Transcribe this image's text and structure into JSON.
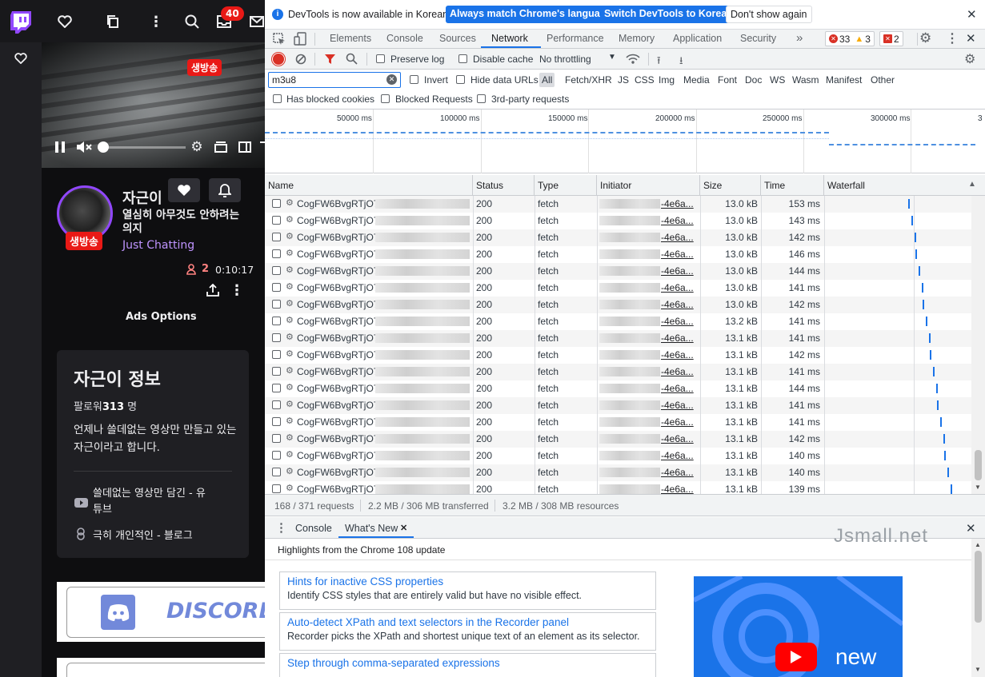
{
  "twitch": {
    "notif_count": "40",
    "live_badge": "생방송",
    "channel_name": "자근이",
    "stream_title": "열심히 아무것도 안하려는 의지",
    "category": "Just Chatting",
    "viewers": "2",
    "uptime": "0:10:17",
    "ads_options": "Ads Options",
    "about_title": "자근이 정보",
    "followers_label": "팔로워",
    "followers_count": "313",
    "followers_unit": "명",
    "bio": "언제나 쓸데없는 영상만 만들고 있는 자근이라고 합니다.",
    "link_youtube": "쓸데없는 영상만 담긴 - 유튜브",
    "link_blog": "극히 개인적인 - 블로그",
    "discord": "DISCORD"
  },
  "devtools": {
    "infobar_text": "DevTools is now available in Korean!",
    "btn_match": "Always match Chrome's language",
    "btn_switch": "Switch DevTools to Korean",
    "btn_dont": "Don't show again",
    "tabs": [
      "Elements",
      "Console",
      "Sources",
      "Network",
      "Performance",
      "Memory",
      "Application",
      "Security"
    ],
    "active_tab": "Network",
    "errors": "33",
    "warnings": "3",
    "issues": "2",
    "preserve_log": "Preserve log",
    "disable_cache": "Disable cache",
    "throttling": "No throttling",
    "filter_value": "m3u8",
    "invert": "Invert",
    "hide_data_urls": "Hide data URLs",
    "type_filters": [
      "All",
      "Fetch/XHR",
      "JS",
      "CSS",
      "Img",
      "Media",
      "Font",
      "Doc",
      "WS",
      "Wasm",
      "Manifest",
      "Other"
    ],
    "blocked_cookies": "Has blocked cookies",
    "blocked_requests": "Blocked Requests",
    "third_party": "3rd-party requests",
    "ruler_ticks": [
      "50000 ms",
      "100000 ms",
      "150000 ms",
      "200000 ms",
      "250000 ms",
      "300000 ms",
      "3"
    ],
    "columns": {
      "name": "Name",
      "status": "Status",
      "type": "Type",
      "initiator": "Initiator",
      "size": "Size",
      "time": "Time",
      "waterfall": "Waterfall"
    },
    "rows": [
      {
        "name": "CogFW6BvgRTjO7",
        "status": "200",
        "type": "fetch",
        "initiator": "-4e6a...",
        "size": "13.0 kB",
        "time": "153 ms",
        "wf": 0.48
      },
      {
        "name": "CogFW6BvgRTjO7",
        "status": "200",
        "type": "fetch",
        "initiator": "-4e6a...",
        "size": "13.0 kB",
        "time": "143 ms",
        "wf": 0.5
      },
      {
        "name": "CogFW6BvgRTjO7",
        "status": "200",
        "type": "fetch",
        "initiator": "-4e6a...",
        "size": "13.0 kB",
        "time": "142 ms",
        "wf": 0.52
      },
      {
        "name": "CogFW6BvgRTjO7",
        "status": "200",
        "type": "fetch",
        "initiator": "-4e6a...",
        "size": "13.0 kB",
        "time": "146 ms",
        "wf": 0.53
      },
      {
        "name": "CogFW6BvgRTjO7",
        "status": "200",
        "type": "fetch",
        "initiator": "-4e6a...",
        "size": "13.0 kB",
        "time": "144 ms",
        "wf": 0.55
      },
      {
        "name": "CogFW6BvgRTjO7",
        "status": "200",
        "type": "fetch",
        "initiator": "-4e6a...",
        "size": "13.0 kB",
        "time": "141 ms",
        "wf": 0.57
      },
      {
        "name": "CogFW6BvgRTjO7",
        "status": "200",
        "type": "fetch",
        "initiator": "-4e6a...",
        "size": "13.0 kB",
        "time": "142 ms",
        "wf": 0.58
      },
      {
        "name": "CogFW6BvgRTjO7",
        "status": "200",
        "type": "fetch",
        "initiator": "-4e6a...",
        "size": "13.2 kB",
        "time": "141 ms",
        "wf": 0.6
      },
      {
        "name": "CogFW6BvgRTjO7",
        "status": "200",
        "type": "fetch",
        "initiator": "-4e6a...",
        "size": "13.1 kB",
        "time": "141 ms",
        "wf": 0.62
      },
      {
        "name": "CogFW6BvgRTjO7",
        "status": "200",
        "type": "fetch",
        "initiator": "-4e6a...",
        "size": "13.1 kB",
        "time": "142 ms",
        "wf": 0.63
      },
      {
        "name": "CogFW6BvgRTjO7",
        "status": "200",
        "type": "fetch",
        "initiator": "-4e6a...",
        "size": "13.1 kB",
        "time": "141 ms",
        "wf": 0.65
      },
      {
        "name": "CogFW6BvgRTjO7",
        "status": "200",
        "type": "fetch",
        "initiator": "-4e6a...",
        "size": "13.1 kB",
        "time": "144 ms",
        "wf": 0.67
      },
      {
        "name": "CogFW6BvgRTjO7",
        "status": "200",
        "type": "fetch",
        "initiator": "-4e6a...",
        "size": "13.1 kB",
        "time": "141 ms",
        "wf": 0.68
      },
      {
        "name": "CogFW6BvgRTjO7",
        "status": "200",
        "type": "fetch",
        "initiator": "-4e6a...",
        "size": "13.1 kB",
        "time": "141 ms",
        "wf": 0.7
      },
      {
        "name": "CogFW6BvgRTjO7",
        "status": "200",
        "type": "fetch",
        "initiator": "-4e6a...",
        "size": "13.1 kB",
        "time": "142 ms",
        "wf": 0.72
      },
      {
        "name": "CogFW6BvgRTjO7",
        "status": "200",
        "type": "fetch",
        "initiator": "-4e6a...",
        "size": "13.1 kB",
        "time": "140 ms",
        "wf": 0.73
      },
      {
        "name": "CogFW6BvgRTjO7",
        "status": "200",
        "type": "fetch",
        "initiator": "-4e6a...",
        "size": "13.1 kB",
        "time": "140 ms",
        "wf": 0.75
      },
      {
        "name": "CogFW6BvgRTjO7",
        "status": "200",
        "type": "fetch",
        "initiator": "-4e6a...",
        "size": "13.1 kB",
        "time": "139 ms",
        "wf": 0.77
      }
    ],
    "status_requests": "168 / 371 requests",
    "status_transferred": "2.2 MB / 306 MB transferred",
    "status_resources": "3.2 MB / 308 MB resources",
    "drawer_console": "Console",
    "drawer_whatsnew": "What's New",
    "highlights": "Highlights from the Chrome 108 update",
    "cards": [
      {
        "title": "Hints for inactive CSS properties",
        "desc": "Identify CSS styles that are entirely valid but have no visible effect."
      },
      {
        "title": "Auto-detect XPath and text selectors in the Recorder panel",
        "desc": "Recorder picks the XPath and shortest unique text of an element as its selector."
      },
      {
        "title": "Step through comma-separated expressions",
        "desc": ""
      }
    ],
    "promo_word": "new"
  },
  "watermark": "Jsmall.net"
}
